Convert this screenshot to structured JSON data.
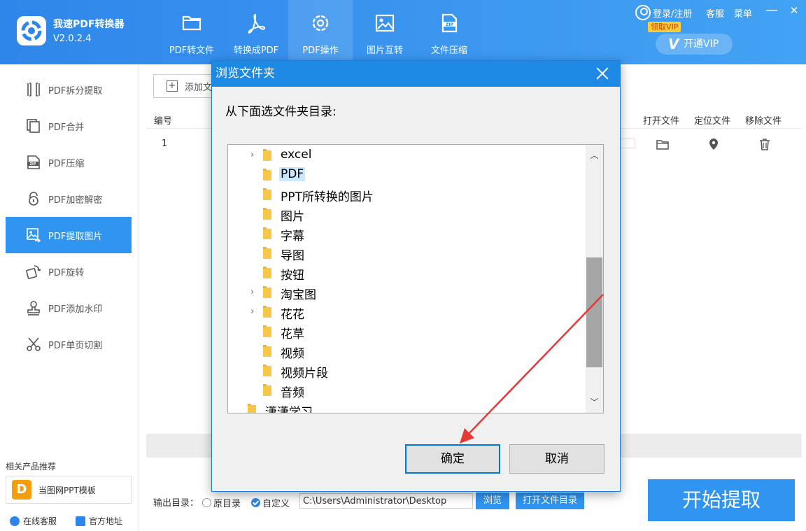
{
  "app": {
    "name": "我速PDF转换器",
    "version": "V2.0.2.4"
  },
  "topnav": [
    {
      "label": "PDF转文件",
      "icon": "folder-icon"
    },
    {
      "label": "转换成PDF",
      "icon": "acrobat-icon"
    },
    {
      "label": "PDF操作",
      "icon": "gear-icon"
    },
    {
      "label": "图片互转",
      "icon": "image-icon"
    },
    {
      "label": "文件压缩",
      "icon": "zip-icon"
    }
  ],
  "header": {
    "login": "登录/注册",
    "service": "客服",
    "menu": "菜单",
    "minimize": "—",
    "close": "✕",
    "badge": "领取VIP",
    "vip_button": "开通VIP",
    "vip_logo": "V"
  },
  "sidebar": {
    "items": [
      {
        "label": "PDF拆分提取",
        "icon": "split-icon"
      },
      {
        "label": "PDF合并",
        "icon": "merge-icon"
      },
      {
        "label": "PDF压缩",
        "icon": "zip-icon"
      },
      {
        "label": "PDF加密解密",
        "icon": "lock-icon"
      },
      {
        "label": "PDF提取图片",
        "icon": "extract-image-icon"
      },
      {
        "label": "PDF旋转",
        "icon": "rotate-icon"
      },
      {
        "label": "PDF添加水印",
        "icon": "stamp-icon"
      },
      {
        "label": "PDF单页切割",
        "icon": "scissors-icon"
      }
    ],
    "recommend_title": "相关产品推荐",
    "recommend_logo": "D",
    "recommend_product": "当图网PPT模板",
    "online_service": "在线客服",
    "official_site": "官方地址"
  },
  "main": {
    "add_button": "添加文",
    "columns": {
      "no": "编号",
      "open": "打开文件",
      "locate": "定位文件",
      "remove": "移除文件"
    },
    "rows": [
      {
        "no": "1"
      }
    ],
    "output_label": "输出目录：",
    "radio_original": "原目录",
    "radio_custom": "自定义",
    "output_path": "C:\\Users\\Administrator\\Desktop",
    "browse": "浏览",
    "open_dir": "打开文件目录",
    "start": "开始提取"
  },
  "dialog": {
    "title": "浏览文件夹",
    "prompt": "从下面选文件夹目录:",
    "folders": [
      {
        "name": "excel",
        "expandable": true
      },
      {
        "name": "PDF",
        "expandable": false,
        "selected": true
      },
      {
        "name": "PPT所转换的图片",
        "expandable": false
      },
      {
        "name": "图片",
        "expandable": false
      },
      {
        "name": "字幕",
        "expandable": false
      },
      {
        "name": "导图",
        "expandable": false
      },
      {
        "name": "按钮",
        "expandable": false
      },
      {
        "name": "淘宝图",
        "expandable": true
      },
      {
        "name": "花花",
        "expandable": true
      },
      {
        "name": "花草",
        "expandable": false
      },
      {
        "name": "视频",
        "expandable": false
      },
      {
        "name": "视频片段",
        "expandable": false
      },
      {
        "name": "音频",
        "expandable": false
      },
      {
        "name": "潇潇学习",
        "expandable": false
      }
    ],
    "ok": "确定",
    "cancel": "取消"
  },
  "colors": {
    "header_blue": "#2f86ea",
    "accent": "#2f95f0",
    "dialog_title": "#1e88e5",
    "annotation_arrow": "#e53935"
  }
}
